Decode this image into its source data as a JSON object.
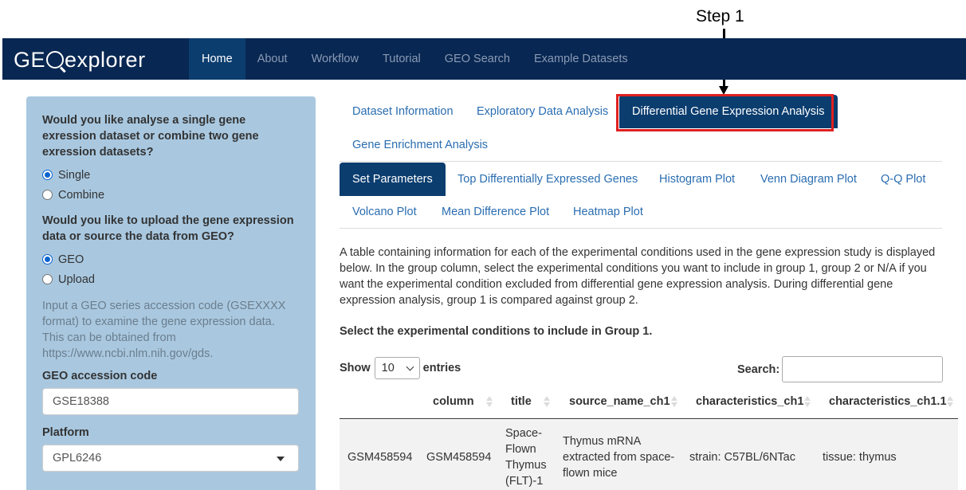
{
  "annotation": {
    "step_label": "Step 1"
  },
  "navbar": {
    "brand_pre": "GE",
    "brand_post": "explorer",
    "links": [
      "Home",
      "About",
      "Workflow",
      "Tutorial",
      "GEO Search",
      "Example Datasets"
    ],
    "active": "Home",
    "bg_color": "#082752"
  },
  "sidebar": {
    "q1": "Would you like analyse a single gene exression dataset or combine two gene exression datasets?",
    "q1_options": [
      "Single",
      "Combine"
    ],
    "q1_selected": "Single",
    "q2": "Would you like to upload the gene expression data or source the data from GEO?",
    "q2_options": [
      "GEO",
      "Upload"
    ],
    "q2_selected": "GEO",
    "help": "Input a GEO series accession code (GSEXXXX format) to examine the gene expression data. This can be obtained from https://www.ncbi.nlm.nih.gov/gds.",
    "geo_label": "GEO accession code",
    "geo_value": "GSE18388",
    "platform_label": "Platform",
    "platform_value": "GPL6246",
    "bg_color": "#a9c8e0"
  },
  "main_tabs": [
    "Dataset Information",
    "Exploratory Data Analysis",
    "Differential Gene Expression Analysis",
    "Gene Enrichment Analysis"
  ],
  "main_tab_active": "Differential Gene Expression Analysis",
  "sub_tabs": [
    "Set Parameters",
    "Top Differentially Expressed Genes",
    "Histogram Plot",
    "Venn Diagram Plot",
    "Q-Q Plot",
    "Volcano Plot",
    "Mean Difference Plot",
    "Heatmap Plot"
  ],
  "sub_tab_active": "Set Parameters",
  "description": "A table containing information for each of the experimental conditions used in the gene expression study is displayed below. In the group column, select the experimental conditions you want to include in group 1, group 2 or N/A if you want the experimental condition excluded from differential gene expression analysis. During differential gene expression analysis, group 1 is compared against group 2.",
  "select_heading": "Select the experimental conditions to include in Group 1.",
  "table_controls": {
    "show": "Show",
    "entries_value": "10",
    "entries": "entries",
    "search_label": "Search:"
  },
  "table": {
    "headers": [
      "column",
      "title",
      "source_name_ch1",
      "characteristics_ch1",
      "characteristics_ch1.1"
    ],
    "rows": [
      [
        "GSM458594",
        "GSM458594",
        "Space-Flown Thymus (FLT)-1",
        "Thymus mRNA extracted from space-flown mice",
        "strain: C57BL/6NTac",
        "tissue: thymus"
      ]
    ]
  },
  "colors": {
    "accent": "#0b3d6f",
    "link": "#2a6db0",
    "highlight": "#e02020"
  }
}
